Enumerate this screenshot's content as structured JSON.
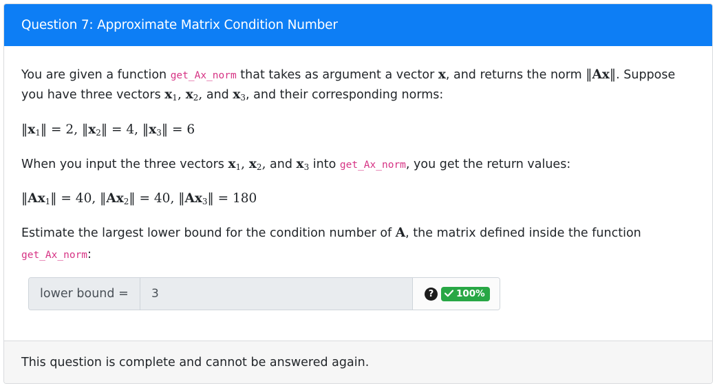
{
  "header": {
    "title": "Question 7: Approximate Matrix Condition Number"
  },
  "body": {
    "p1_a": "You are given a function ",
    "fn_name": "get_Ax_norm",
    "p1_b": " that takes as argument a vector ",
    "p1_c": ", and returns the norm ",
    "p1_d": ". Suppose",
    "p2_a": "you have three vectors ",
    "p2_b": ", and their corresponding norms:",
    "norms_eq": "‖x₁‖ = 2, ‖x₂‖ = 4, ‖x₃‖ = 6",
    "p3_a": "When you input the three vectors ",
    "p3_b": " into ",
    "p3_c": ", you get the return values:",
    "ax_eq": "‖Ax₁‖ = 40, ‖Ax₂‖ = 40, ‖Ax₃‖ = 180",
    "p4_a": "Estimate the largest lower bound for the condition number of ",
    "p4_b": ", the matrix defined inside the function",
    "p4_end": ":"
  },
  "answer": {
    "label": "lower bound =",
    "value": "3",
    "help_icon": "question-circle-icon",
    "score_badge": "100%",
    "check_icon": "check-icon"
  },
  "footer": {
    "status": "This question is complete and cannot be answered again."
  },
  "colors": {
    "header_bg": "#0d7ef5",
    "code": "#d63384",
    "badge": "#28a745"
  }
}
